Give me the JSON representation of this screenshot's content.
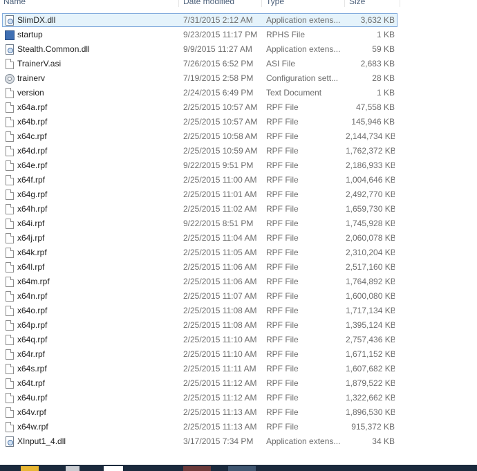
{
  "columns": {
    "name": "Name",
    "date": "Date modified",
    "type": "Type",
    "size": "Size"
  },
  "files": [
    {
      "name": "SlimDX.dll",
      "date": "7/31/2015 2:12 AM",
      "type": "Application extens...",
      "size": "3,632 KB",
      "icon": "dll-icon",
      "selected": true
    },
    {
      "name": "startup",
      "date": "9/23/2015 11:17 PM",
      "type": "RPHS File",
      "size": "1 KB",
      "icon": "rphs-file-icon"
    },
    {
      "name": "Stealth.Common.dll",
      "date": "9/9/2015 11:27 AM",
      "type": "Application extens...",
      "size": "59 KB",
      "icon": "dll-icon"
    },
    {
      "name": "TrainerV.asi",
      "date": "7/26/2015 6:52 PM",
      "type": "ASI File",
      "size": "2,683 KB",
      "icon": "file-icon"
    },
    {
      "name": "trainerv",
      "date": "7/19/2015 2:58 PM",
      "type": "Configuration sett...",
      "size": "28 KB",
      "icon": "config-icon"
    },
    {
      "name": "version",
      "date": "2/24/2015 6:49 PM",
      "type": "Text Document",
      "size": "1 KB",
      "icon": "file-icon"
    },
    {
      "name": "x64a.rpf",
      "date": "2/25/2015 10:57 AM",
      "type": "RPF File",
      "size": "47,558 KB",
      "icon": "file-icon"
    },
    {
      "name": "x64b.rpf",
      "date": "2/25/2015 10:57 AM",
      "type": "RPF File",
      "size": "145,946 KB",
      "icon": "file-icon"
    },
    {
      "name": "x64c.rpf",
      "date": "2/25/2015 10:58 AM",
      "type": "RPF File",
      "size": "2,144,734 KB",
      "icon": "file-icon"
    },
    {
      "name": "x64d.rpf",
      "date": "2/25/2015 10:59 AM",
      "type": "RPF File",
      "size": "1,762,372 KB",
      "icon": "file-icon"
    },
    {
      "name": "x64e.rpf",
      "date": "9/22/2015 9:51 PM",
      "type": "RPF File",
      "size": "2,186,933 KB",
      "icon": "file-icon"
    },
    {
      "name": "x64f.rpf",
      "date": "2/25/2015 11:00 AM",
      "type": "RPF File",
      "size": "1,004,646 KB",
      "icon": "file-icon"
    },
    {
      "name": "x64g.rpf",
      "date": "2/25/2015 11:01 AM",
      "type": "RPF File",
      "size": "2,492,770 KB",
      "icon": "file-icon"
    },
    {
      "name": "x64h.rpf",
      "date": "2/25/2015 11:02 AM",
      "type": "RPF File",
      "size": "1,659,730 KB",
      "icon": "file-icon"
    },
    {
      "name": "x64i.rpf",
      "date": "9/22/2015 8:51 PM",
      "type": "RPF File",
      "size": "1,745,928 KB",
      "icon": "file-icon"
    },
    {
      "name": "x64j.rpf",
      "date": "2/25/2015 11:04 AM",
      "type": "RPF File",
      "size": "2,060,078 KB",
      "icon": "file-icon"
    },
    {
      "name": "x64k.rpf",
      "date": "2/25/2015 11:05 AM",
      "type": "RPF File",
      "size": "2,310,204 KB",
      "icon": "file-icon"
    },
    {
      "name": "x64l.rpf",
      "date": "2/25/2015 11:06 AM",
      "type": "RPF File",
      "size": "2,517,160 KB",
      "icon": "file-icon"
    },
    {
      "name": "x64m.rpf",
      "date": "2/25/2015 11:06 AM",
      "type": "RPF File",
      "size": "1,764,892 KB",
      "icon": "file-icon"
    },
    {
      "name": "x64n.rpf",
      "date": "2/25/2015 11:07 AM",
      "type": "RPF File",
      "size": "1,600,080 KB",
      "icon": "file-icon"
    },
    {
      "name": "x64o.rpf",
      "date": "2/25/2015 11:08 AM",
      "type": "RPF File",
      "size": "1,717,134 KB",
      "icon": "file-icon"
    },
    {
      "name": "x64p.rpf",
      "date": "2/25/2015 11:08 AM",
      "type": "RPF File",
      "size": "1,395,124 KB",
      "icon": "file-icon"
    },
    {
      "name": "x64q.rpf",
      "date": "2/25/2015 11:10 AM",
      "type": "RPF File",
      "size": "2,757,436 KB",
      "icon": "file-icon"
    },
    {
      "name": "x64r.rpf",
      "date": "2/25/2015 11:10 AM",
      "type": "RPF File",
      "size": "1,671,152 KB",
      "icon": "file-icon"
    },
    {
      "name": "x64s.rpf",
      "date": "2/25/2015 11:11 AM",
      "type": "RPF File",
      "size": "1,607,682 KB",
      "icon": "file-icon"
    },
    {
      "name": "x64t.rpf",
      "date": "2/25/2015 11:12 AM",
      "type": "RPF File",
      "size": "1,879,522 KB",
      "icon": "file-icon"
    },
    {
      "name": "x64u.rpf",
      "date": "2/25/2015 11:12 AM",
      "type": "RPF File",
      "size": "1,322,662 KB",
      "icon": "file-icon"
    },
    {
      "name": "x64v.rpf",
      "date": "2/25/2015 11:13 AM",
      "type": "RPF File",
      "size": "1,896,530 KB",
      "icon": "file-icon"
    },
    {
      "name": "x64w.rpf",
      "date": "2/25/2015 11:13 AM",
      "type": "RPF File",
      "size": "915,372 KB",
      "icon": "file-icon"
    },
    {
      "name": "XInput1_4.dll",
      "date": "3/17/2015 7:34 PM",
      "type": "Application extens...",
      "size": "34 KB",
      "icon": "dll-icon"
    }
  ],
  "colors": {
    "selection_bg": "#e5f3fb",
    "selection_border": "#84acdd",
    "header_text": "#4c607a",
    "taskbar": "#1b2a3d"
  }
}
